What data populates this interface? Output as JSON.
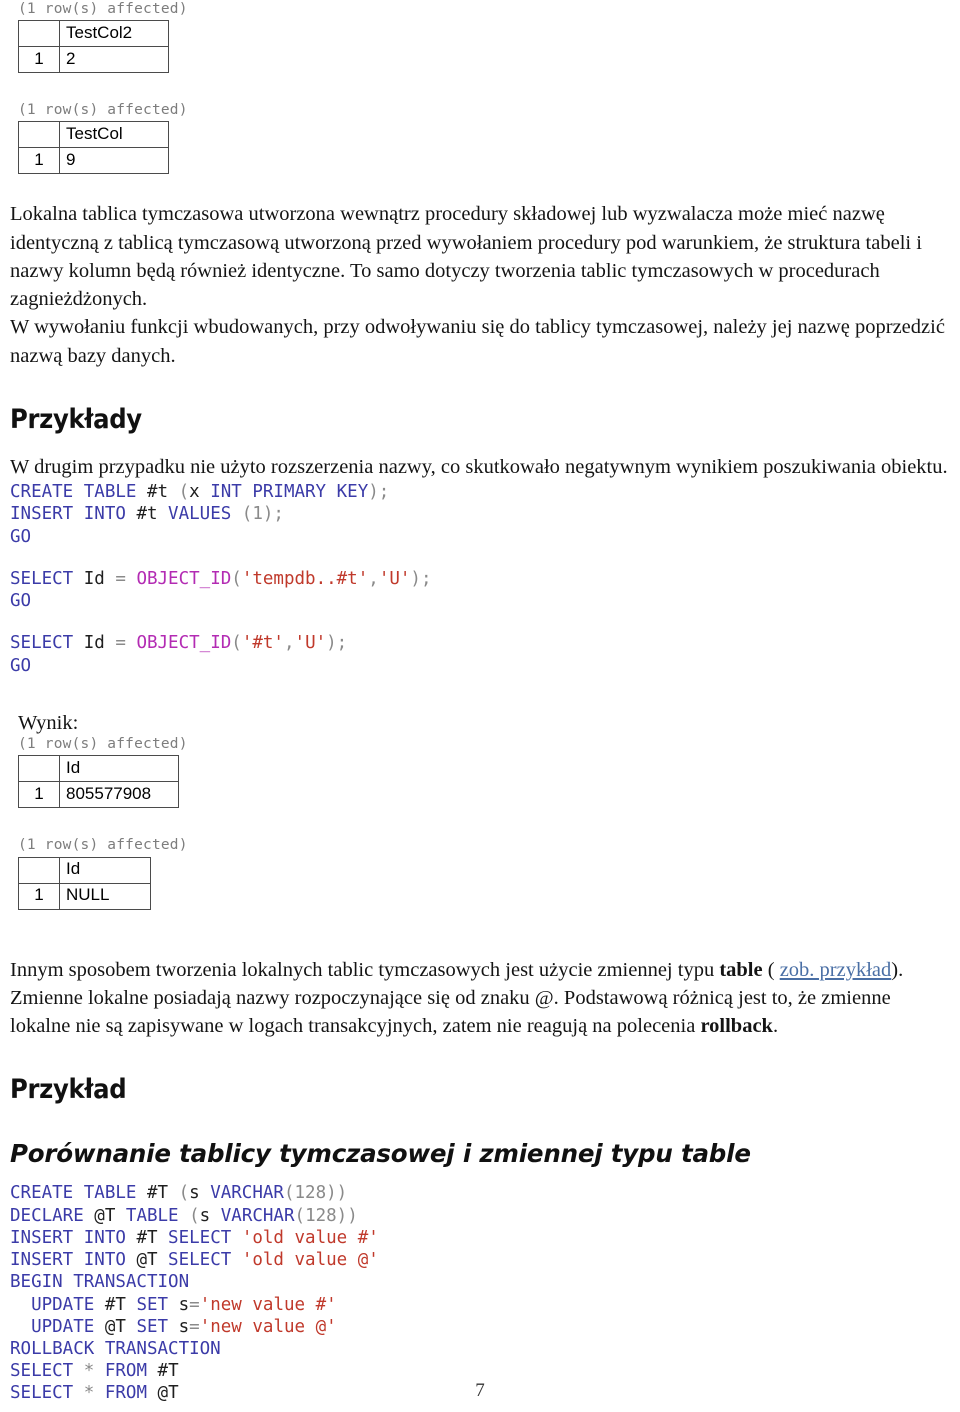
{
  "document": {
    "page_number": "7",
    "language": "pl"
  },
  "result_blocks": [
    {
      "affected": "(1 row(s) affected)",
      "header": [
        "",
        "TestCol2"
      ],
      "rows": [
        [
          "1",
          "2"
        ]
      ]
    },
    {
      "affected": "(1 row(s) affected)",
      "header": [
        "",
        "TestCol"
      ],
      "rows": [
        [
          "1",
          "9"
        ]
      ]
    },
    {
      "affected": "(1 row(s) affected)",
      "header": [
        "",
        "Id"
      ],
      "rows": [
        [
          "1",
          "805577908"
        ]
      ]
    },
    {
      "affected": "(1 row(s) affected)",
      "header": [
        "",
        "Id"
      ],
      "rows": [
        [
          "1",
          "NULL"
        ]
      ]
    }
  ],
  "paragraphs": {
    "intro_1": "Lokalna tablica tymczasowa utworzona wewnątrz procedury składowej lub wyzwalacza może mieć nazwę identyczną z tablicą tymczasową utworzoną przed wywołaniem procedury pod warunkiem, że struktura tabeli i nazwy kolumn będą również identyczne. To samo dotyczy tworzenia tablic tymczasowych w procedurach zagnieżdżonych.",
    "intro_2": "W wywołaniu funkcji wbudowanych, przy odwoływaniu się do tablicy tymczasowej, należy jej nazwę poprzedzić nazwą bazy danych.",
    "examples_lead": "W drugim przypadku nie użyto rozszerzenia nazwy, co skutkowało negatywnym wynikiem poszukiwania obiektu.",
    "variables_1_a": "Innym sposobem tworzenia lokalnych tablic tymczasowych jest użycie zmiennej typu ",
    "variables_1_bold": "table",
    "variables_1_b": " ( ",
    "variables_1_link": "zob. przykład",
    "variables_1_c": ").",
    "variables_2_a": "Zmienne lokalne posiadają nazwy rozpoczynające się od znaku @. Podstawową różnicą jest to, że zmienne lokalne nie są zapisywane w logach transakcyjnych, zatem nie reagują na polecenia ",
    "variables_2_bold": "rollback",
    "variables_2_c": "."
  },
  "headings": {
    "examples": "Przykłady",
    "example": "Przykład",
    "comparison_subtitle": "Porównanie tablicy tymczasowej i zmiennej typu table",
    "result_label": "Wynik:"
  },
  "code_blocks": {
    "create_insert": [
      {
        "tokens": [
          {
            "t": "CREATE TABLE ",
            "c": "kw"
          },
          {
            "t": "#t",
            "c": "ident"
          },
          {
            "t": " (",
            "c": "punc"
          },
          {
            "t": "x ",
            "c": "ident"
          },
          {
            "t": "INT PRIMARY KEY",
            "c": "kw"
          },
          {
            "t": ");",
            "c": "punc"
          }
        ]
      },
      {
        "tokens": [
          {
            "t": "INSERT INTO ",
            "c": "kw"
          },
          {
            "t": "#t ",
            "c": "ident"
          },
          {
            "t": "VALUES",
            "c": "kw"
          },
          {
            "t": " (",
            "c": "punc"
          },
          {
            "t": "1",
            "c": "punc"
          },
          {
            "t": ");",
            "c": "punc"
          }
        ]
      },
      {
        "tokens": [
          {
            "t": "GO",
            "c": "kw"
          }
        ]
      }
    ],
    "select_tempdb": [
      {
        "tokens": [
          {
            "t": "SELECT ",
            "c": "kw"
          },
          {
            "t": "Id ",
            "c": "ident"
          },
          {
            "t": "= ",
            "c": "op"
          },
          {
            "t": "OBJECT_ID",
            "c": "fn"
          },
          {
            "t": "(",
            "c": "punc"
          },
          {
            "t": "'tempdb..#t'",
            "c": "str"
          },
          {
            "t": ",",
            "c": "punc"
          },
          {
            "t": "'U'",
            "c": "str"
          },
          {
            "t": ");",
            "c": "punc"
          }
        ]
      },
      {
        "tokens": [
          {
            "t": "GO",
            "c": "kw"
          }
        ]
      }
    ],
    "select_short": [
      {
        "tokens": [
          {
            "t": "SELECT ",
            "c": "kw"
          },
          {
            "t": "Id ",
            "c": "ident"
          },
          {
            "t": "= ",
            "c": "op"
          },
          {
            "t": "OBJECT_ID",
            "c": "fn"
          },
          {
            "t": "(",
            "c": "punc"
          },
          {
            "t": "'#t'",
            "c": "str"
          },
          {
            "t": ",",
            "c": "punc"
          },
          {
            "t": "'U'",
            "c": "str"
          },
          {
            "t": ");",
            "c": "punc"
          }
        ]
      },
      {
        "tokens": [
          {
            "t": "GO",
            "c": "kw"
          }
        ]
      }
    ],
    "comparison": [
      {
        "tokens": [
          {
            "t": "CREATE TABLE ",
            "c": "kw"
          },
          {
            "t": "#T ",
            "c": "ident"
          },
          {
            "t": "(",
            "c": "punc"
          },
          {
            "t": "s ",
            "c": "ident"
          },
          {
            "t": "VARCHAR",
            "c": "kw"
          },
          {
            "t": "(",
            "c": "punc"
          },
          {
            "t": "128",
            "c": "punc"
          },
          {
            "t": "))",
            "c": "punc"
          }
        ]
      },
      {
        "tokens": [
          {
            "t": "DECLARE ",
            "c": "kw"
          },
          {
            "t": "@T ",
            "c": "ident"
          },
          {
            "t": "TABLE ",
            "c": "kw"
          },
          {
            "t": "(",
            "c": "punc"
          },
          {
            "t": "s ",
            "c": "ident"
          },
          {
            "t": "VARCHAR",
            "c": "kw"
          },
          {
            "t": "(",
            "c": "punc"
          },
          {
            "t": "128",
            "c": "punc"
          },
          {
            "t": "))",
            "c": "punc"
          }
        ]
      },
      {
        "tokens": [
          {
            "t": "INSERT INTO ",
            "c": "kw"
          },
          {
            "t": "#T ",
            "c": "ident"
          },
          {
            "t": "SELECT ",
            "c": "kw"
          },
          {
            "t": "'old value #'",
            "c": "str"
          }
        ]
      },
      {
        "tokens": [
          {
            "t": "INSERT INTO ",
            "c": "kw"
          },
          {
            "t": "@T ",
            "c": "ident"
          },
          {
            "t": "SELECT ",
            "c": "kw"
          },
          {
            "t": "'old value @'",
            "c": "str"
          }
        ]
      },
      {
        "tokens": [
          {
            "t": "BEGIN TRANSACTION",
            "c": "kw"
          }
        ]
      },
      {
        "tokens": [
          {
            "t": "  UPDATE ",
            "c": "kw"
          },
          {
            "t": "#T ",
            "c": "ident"
          },
          {
            "t": "SET ",
            "c": "kw"
          },
          {
            "t": "s",
            "c": "ident"
          },
          {
            "t": "=",
            "c": "op"
          },
          {
            "t": "'new value #'",
            "c": "str"
          }
        ]
      },
      {
        "tokens": [
          {
            "t": "  UPDATE ",
            "c": "kw"
          },
          {
            "t": "@T ",
            "c": "ident"
          },
          {
            "t": "SET ",
            "c": "kw"
          },
          {
            "t": "s",
            "c": "ident"
          },
          {
            "t": "=",
            "c": "op"
          },
          {
            "t": "'new value @'",
            "c": "str"
          }
        ]
      },
      {
        "tokens": [
          {
            "t": "ROLLBACK TRANSACTION",
            "c": "kw"
          }
        ]
      },
      {
        "tokens": [
          {
            "t": "SELECT ",
            "c": "kw"
          },
          {
            "t": "* ",
            "c": "op"
          },
          {
            "t": "FROM ",
            "c": "kw"
          },
          {
            "t": "#T",
            "c": "ident"
          }
        ]
      },
      {
        "tokens": [
          {
            "t": "SELECT ",
            "c": "kw"
          },
          {
            "t": "* ",
            "c": "op"
          },
          {
            "t": "FROM ",
            "c": "kw"
          },
          {
            "t": "@T",
            "c": "ident"
          }
        ]
      }
    ]
  },
  "colors": {
    "keyword": "#3b3ba8",
    "string": "#c0392b",
    "function": "#b32bb3",
    "punctuation": "#8a8a8a",
    "link": "#4a6fa5",
    "console_gray": "#7d7d7d"
  }
}
